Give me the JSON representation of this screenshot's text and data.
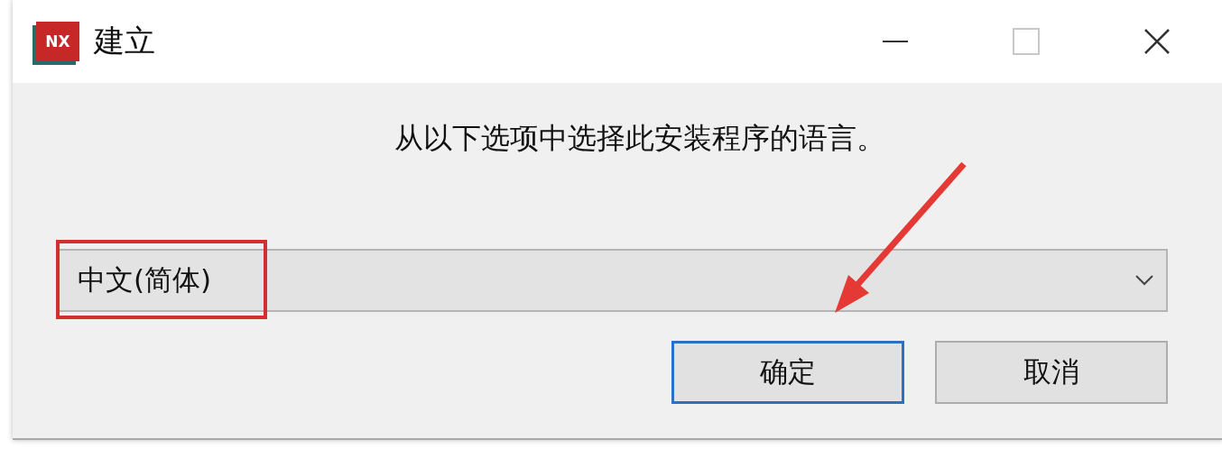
{
  "window": {
    "title": "建立",
    "logo": "NX",
    "maximize_disabled": true
  },
  "prompt": "从以下选项中选择此安装程序的语言。",
  "language_select": {
    "value": "中文(简体)",
    "highlighted": true
  },
  "buttons": [
    {
      "label": "确定",
      "default": true
    },
    {
      "label": "取消",
      "default": false
    }
  ]
}
